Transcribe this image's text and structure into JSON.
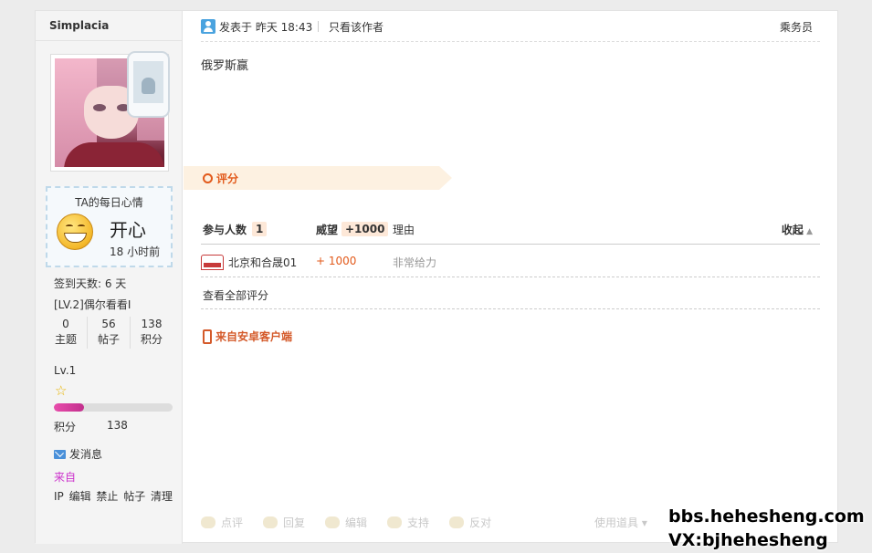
{
  "user": {
    "name": "Simplacia",
    "mood_title": "TA的每日心情",
    "mood_word": "开心",
    "mood_time": "18 小时前",
    "sign_days": "签到天数: 6 天",
    "level_title": "[LV.2]偶尔看看I",
    "stats": [
      {
        "num": "0",
        "label": "主题"
      },
      {
        "num": "56",
        "label": "帖子"
      },
      {
        "num": "138",
        "label": "积分"
      }
    ],
    "lv": "Lv.1",
    "level_progress": 0.25,
    "credit_label": "积分",
    "credit_value": "138",
    "send_message": "发消息",
    "from_label": "来自",
    "admin_links": "IP 编辑 禁止 帖子 清理"
  },
  "post": {
    "posted": "发表于 昨天 18:43",
    "only_author": "只看该作者",
    "floor": "乘务员",
    "content": "俄罗斯赢"
  },
  "rating": {
    "tab_label": "评分",
    "participants_label": "参与人数",
    "participants_count": "1",
    "weili_label": "威望",
    "weili_total": "+1000",
    "reason_label": "理由",
    "collapse_label": "收起",
    "rows": [
      {
        "user": "北京和合晟01",
        "score": "+ 1000",
        "reason": "非常给力"
      }
    ],
    "view_all": "查看全部评分"
  },
  "client_from": "来自安卓客户端",
  "actions": [
    "点评",
    "回复",
    "编辑",
    "支持",
    "反对"
  ],
  "tools_label": "使用道具",
  "watermark": {
    "line1": "bbs.hehesheng.com",
    "line2": "VX:bjhehesheng"
  },
  "colors": {
    "accent_orange": "#e25a1b",
    "from_magenta": "#cc33cc",
    "progress_pink": "#e84cab"
  }
}
